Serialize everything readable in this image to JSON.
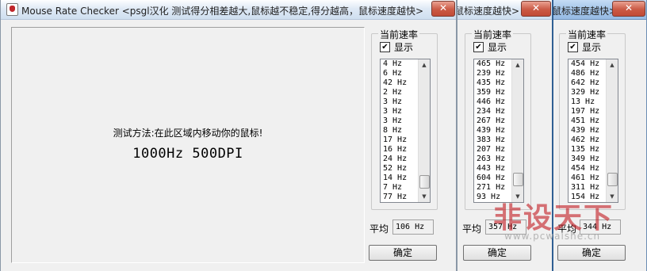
{
  "windows": [
    {
      "title": "Mouse Rate Checker <psgl汉化  测试得分相差越大,鼠标越不稳定,得分越高，鼠标速度越快>",
      "close_label": "✕",
      "test_area": {
        "hint": "测试方法:在此区域内移动你的鼠标!",
        "rate_line": "1000Hz 500DPI"
      },
      "panel": {
        "group_label": "当前速率",
        "show_label": "显示",
        "rates": [
          "4 Hz",
          "6 Hz",
          "42 Hz",
          "2 Hz",
          "3 Hz",
          "3 Hz",
          "3 Hz",
          "8 Hz",
          "17 Hz",
          "16 Hz",
          "24 Hz",
          "52 Hz",
          "14 Hz",
          "7 Hz",
          "77 Hz"
        ],
        "average_label": "平均",
        "average_value": "106 Hz",
        "ok_label": "确定"
      }
    },
    {
      "title": "鼠标速度越快>",
      "close_label": "✕",
      "panel": {
        "group_label": "当前速率",
        "show_label": "显示",
        "rates": [
          "465 Hz",
          "239 Hz",
          "435 Hz",
          "359 Hz",
          "446 Hz",
          "234 Hz",
          "267 Hz",
          "439 Hz",
          "383 Hz",
          "207 Hz",
          "263 Hz",
          "443 Hz",
          "604 Hz",
          "271 Hz",
          "93 Hz"
        ],
        "average_label": "平均",
        "average_value": "357 Hz",
        "ok_label": "确定"
      }
    },
    {
      "title": "鼠标速度越快>",
      "close_label": "✕",
      "panel": {
        "group_label": "当前速率",
        "show_label": "显示",
        "rates": [
          "454 Hz",
          "486 Hz",
          "642 Hz",
          "329 Hz",
          "13 Hz",
          "197 Hz",
          "451 Hz",
          "439 Hz",
          "462 Hz",
          "135 Hz",
          "349 Hz",
          "454 Hz",
          "461 Hz",
          "311 Hz",
          "154 Hz"
        ],
        "average_label": "平均",
        "average_value": "344 Hz",
        "ok_label": "确定"
      }
    }
  ],
  "scroll": {
    "up_arrow": "▲",
    "down_arrow": "▼"
  },
  "checkbox_mark": "✔",
  "icons": {
    "app": "mouse-app-icon",
    "close": "close-icon",
    "check": "check-icon",
    "scroll_up": "scroll-up-arrow-icon",
    "scroll_down": "scroll-down-arrow-icon"
  },
  "watermark": {
    "logo": "非设天下",
    "url": "www.pcwaishe.cn"
  },
  "colors": {
    "close_button": "#c94f3c",
    "active_border": "#2f5f93",
    "watermark": "#c42026"
  }
}
